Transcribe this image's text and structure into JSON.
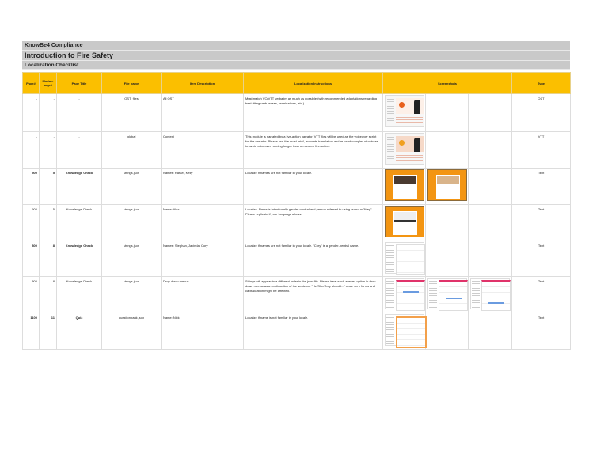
{
  "header": {
    "company": "KnowBe4 Compliance",
    "course": "Introduction to Fire Safety",
    "doc": "Localization Checklist"
  },
  "columns": [
    "Page#",
    "Module page#",
    "Page Title",
    "File name",
    "Item Description",
    "Localization Instructions",
    "Screenshots",
    "Type"
  ],
  "rows": [
    {
      "page": "-",
      "module": "-",
      "title": "-",
      "file": "OST_files",
      "item": "All OST",
      "instr": "Must match VO/VTT verbatim as much as possible (with recommended adaptations regarding best fitting verb tenses, terminations, etc.)",
      "type": "OST",
      "bold": false
    },
    {
      "page": "-",
      "module": "-",
      "title": "-",
      "file": "global",
      "item": "Context",
      "instr": "This module is narrated by a live-action narrator. VTT files will be used as the voiceover script for the narrator. Please use the most brief, accurate translation and re-word complex structures to avoid voiceover running longer than on-screen live-action.",
      "type": "VTT",
      "bold": false
    },
    {
      "page": "500",
      "module": "5",
      "title": "Knowledge Check",
      "file": "strings.json",
      "item": "Names: Rafael, Kelly",
      "instr": "Localize if names are not familiar in your locale.",
      "type": "Text",
      "bold": true
    },
    {
      "page": "500",
      "module": "5",
      "title": "Knowledge Check",
      "file": "strings.json",
      "item": "Name: Alex",
      "instr": "Localize. Name is intentionally gender neutral and person referred to using pronoun \"they\". Please replicate if your language allows.",
      "type": "Text",
      "bold": false
    },
    {
      "page": "800",
      "module": "8",
      "title": "Knowledge Check",
      "file": "strings.json",
      "item": "Names: Stephan, Jacinda, Cory",
      "instr": "Localize if names are not familiar in your locale. \"Cory\" is a gender-neutral name.",
      "type": "Text",
      "bold": true
    },
    {
      "page": "800",
      "module": "8",
      "title": "Knowledge Check",
      "file": "strings.json",
      "item": "Drop-down menus",
      "instr": "Strings will appear in a different order in the json file. Please treat each answer option in drop-down menus as a continuation of the sentence \"He/She/Cory should...\" since verb forms and capitalization might be affected.",
      "type": "Text",
      "bold": false
    },
    {
      "page": "1100",
      "module": "11",
      "title": "Quiz",
      "file": "questionbank.json",
      "item": "Name: Nick",
      "instr": "Localize if name is not familiar in your locale.",
      "type": "Text",
      "bold": true
    }
  ]
}
